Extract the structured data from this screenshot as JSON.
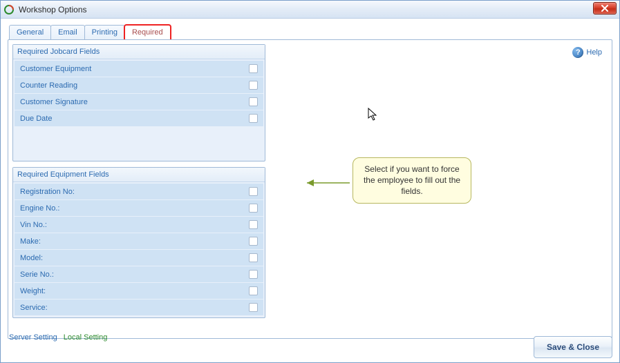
{
  "window": {
    "title": "Workshop Options"
  },
  "tabs": {
    "general": "General",
    "email": "Email",
    "printing": "Printing",
    "required": "Required"
  },
  "groups": {
    "jobcard": {
      "title": "Required Jobcard Fields",
      "rows": {
        "customer_equipment": "Customer Equipment",
        "counter_reading": "Counter Reading",
        "customer_signature": "Customer Signature",
        "due_date": "Due Date"
      }
    },
    "equipment": {
      "title": "Required Equipment Fields",
      "rows": {
        "registration_no": "Registration No:",
        "engine_no": "Engine No.:",
        "vin_no": "Vin No.:",
        "make": "Make:",
        "model": "Model:",
        "serie_no": "Serie No.:",
        "weight": "Weight:",
        "service": "Service:"
      }
    }
  },
  "help": {
    "label": "Help"
  },
  "callout": {
    "text": "Select if you want to force the employee to fill out the fields."
  },
  "footer": {
    "server_setting": "Server Setting",
    "local_setting": "Local Setting",
    "save_close": "Save & Close"
  }
}
